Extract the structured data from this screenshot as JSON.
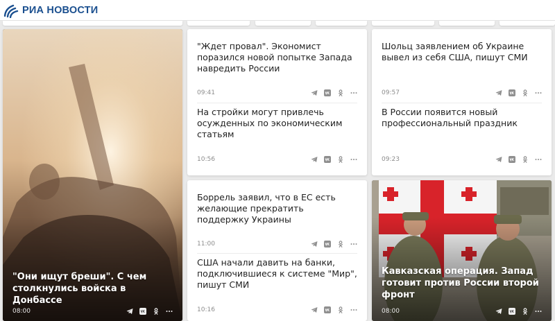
{
  "header": {
    "logo_text": "РИА НОВОСТИ"
  },
  "share_icons": [
    "telegram-icon",
    "vk-icon",
    "odnoklassniki-icon",
    "more-icon"
  ],
  "colors": {
    "brand": "#1a4f8f",
    "background": "#eaeaea",
    "card": "#ffffff",
    "meta_text": "#8c8c8c"
  },
  "cards": {
    "donbass": {
      "title": "\"Они ищут бреши\". С чем столкнулись войска в Донбассе",
      "time": "08:00"
    },
    "col2_top": [
      {
        "title": "\"Ждет провал\". Экономист поразился новой попытке Запада навредить России",
        "time": "09:41"
      },
      {
        "title": "На стройки могут привлечь осужденных по экономическим статьям",
        "time": "10:56"
      }
    ],
    "col3_top": [
      {
        "title": "Шольц заявлением об Украине вывел из себя США, пишут СМИ",
        "time": "09:57"
      },
      {
        "title": "В России появится новый профессиональный праздник",
        "time": "09:23"
      }
    ],
    "col2_bottom": [
      {
        "title": "Боррель заявил, что в ЕС есть желающие прекратить поддержку Украины",
        "time": "11:00"
      },
      {
        "title": "США начали давить на банки, подключившиеся к системе \"Мир\", пишут СМИ",
        "time": "10:16"
      }
    ],
    "caucasus": {
      "title": "Кавказская операция. Запад готовит против России второй фронт",
      "time": "08:00"
    }
  }
}
